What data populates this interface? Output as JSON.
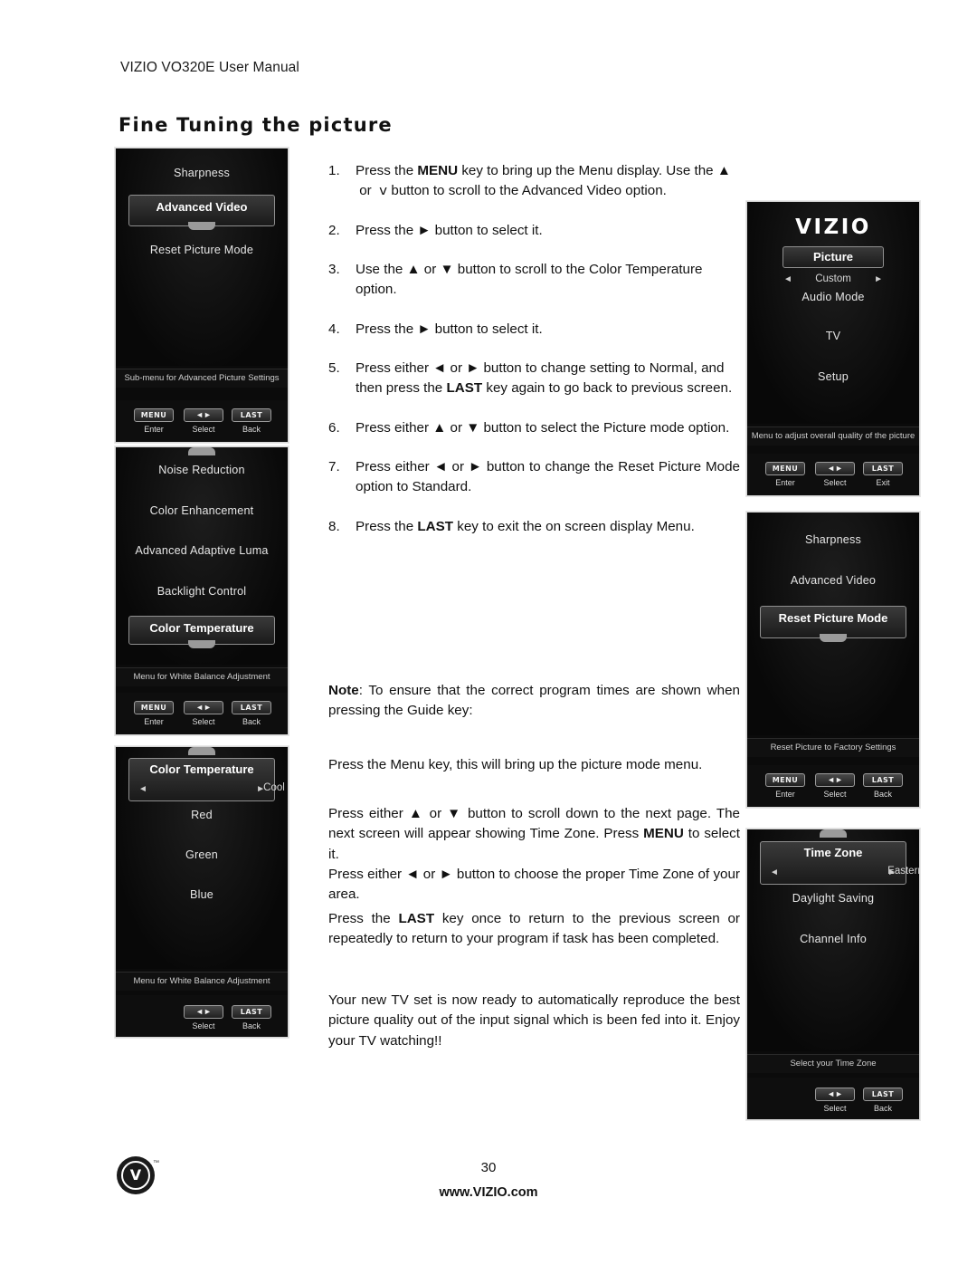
{
  "header": {
    "doc_title": "VIZIO VO320E User Manual",
    "section_title": "Fine Tuning the picture"
  },
  "footer": {
    "page_number": "30",
    "url": "www.VIZIO.com",
    "logo_mark": "V",
    "trademark": "™"
  },
  "instructions": [
    {
      "num": "1.",
      "html": "Press the <b>MENU</b> key to bring up the Menu display. Use the ▲ &nbsp;or&nbsp; ⅴ button to scroll to the Advanced Video option."
    },
    {
      "num": "2.",
      "html": "Press the ► button to select it."
    },
    {
      "num": "3.",
      "html": "Use the ▲ or ▼ button to scroll to the Color Temperature option."
    },
    {
      "num": "4.",
      "html": "Press the ► button to select it."
    },
    {
      "num": "5.",
      "html": "Press either ◄ or ► button to change setting to Normal, and then press the <b>LAST</b> key again to go back to previous screen."
    },
    {
      "num": "6.",
      "html": "Press either ▲ or ▼ button to select the Picture mode option."
    },
    {
      "num": "7.",
      "html": "Press either ◄ or ► button to change the Reset Picture Mode option to Standard."
    },
    {
      "num": "8.",
      "html": "Press the <b>LAST</b> key to exit the on screen display Menu."
    }
  ],
  "note": "<b>Note</b>: To ensure that the correct program times are shown when pressing the Guide key:",
  "paragraphs": [
    "Press the Menu key, this will bring up the picture mode menu.",
    "Press either ▲ or ▼ button to scroll down to the next page. The next screen will appear showing Time Zone. Press <b>MENU</b> to select it.",
    "Press either ◄ or ► button to choose the proper Time Zone of your area.",
    "Press the <b>LAST</b> key once to return to the previous screen or repeatedly to return to your program if task has been completed.",
    "Your new TV set is now ready to automatically reproduce the best picture quality out of the input signal which is been fed into it. Enjoy your TV watching!!"
  ],
  "osd_panels": {
    "advanced_video": {
      "items": [
        "Sharpness",
        "Reset Picture Mode"
      ],
      "highlighted": "Advanced Video",
      "caption": "Sub-menu for Advanced Picture Settings",
      "keys": [
        {
          "cap": "MENU",
          "label": "Enter"
        },
        {
          "cap": "◄►",
          "label": "Select"
        },
        {
          "cap": "LAST",
          "label": "Back"
        }
      ]
    },
    "color_temperature_menu": {
      "items": [
        "Noise Reduction",
        "Color Enhancement",
        "Advanced Adaptive Luma",
        "Backlight Control"
      ],
      "highlighted": "Color Temperature",
      "caption": "Menu for White Balance Adjustment",
      "keys": [
        {
          "cap": "MENU",
          "label": "Enter"
        },
        {
          "cap": "◄►",
          "label": "Select"
        },
        {
          "cap": "LAST",
          "label": "Back"
        }
      ]
    },
    "color_temperature_detail": {
      "highlighted": "Color Temperature",
      "highlight_value": "Cool",
      "items": [
        "Red",
        "Green",
        "Blue"
      ],
      "caption": "Menu for White Balance Adjustment",
      "keys": [
        {
          "cap": "◄►",
          "label": "Select"
        },
        {
          "cap": "LAST",
          "label": "Back"
        }
      ]
    },
    "picture_menu": {
      "logo": "VIZIO",
      "highlighted": "Picture",
      "highlight_value": "Custom",
      "items": [
        "Audio Mode",
        "TV",
        "Setup"
      ],
      "caption": "Menu to adjust overall quality of the picture",
      "keys": [
        {
          "cap": "MENU",
          "label": "Enter"
        },
        {
          "cap": "◄►",
          "label": "Select"
        },
        {
          "cap": "LAST",
          "label": "Exit"
        }
      ]
    },
    "reset_picture_mode": {
      "items": [
        "Sharpness",
        "Advanced Video"
      ],
      "highlighted": "Reset Picture Mode",
      "caption": "Reset Picture to Factory Settings",
      "keys": [
        {
          "cap": "MENU",
          "label": "Enter"
        },
        {
          "cap": "◄►",
          "label": "Select"
        },
        {
          "cap": "LAST",
          "label": "Back"
        }
      ]
    },
    "time_zone": {
      "highlighted": "Time Zone",
      "highlight_value": "Eastern",
      "items": [
        "Daylight Saving",
        "Channel Info"
      ],
      "caption": "Select your Time Zone",
      "keys": [
        {
          "cap": "◄►",
          "label": "Select"
        },
        {
          "cap": "LAST",
          "label": "Back"
        }
      ]
    }
  }
}
